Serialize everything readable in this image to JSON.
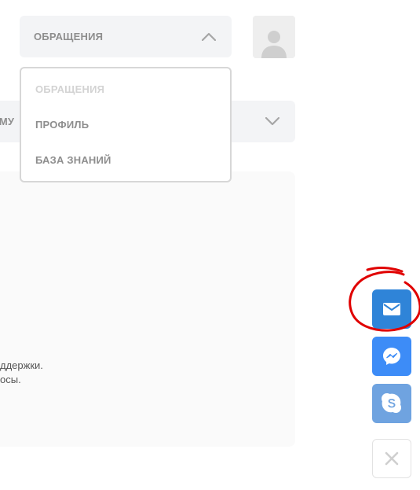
{
  "nav": {
    "selected": "ОБРАЩЕНИЯ",
    "menu_items": [
      {
        "label": "ОБРАЩЕНИЯ",
        "active": true
      },
      {
        "label": "ПРОФИЛЬ",
        "active": false
      },
      {
        "label": "БАЗА ЗНАНИЙ",
        "active": false
      }
    ]
  },
  "topic_select": {
    "label_fragment": "ЕМУ"
  },
  "content": {
    "line1": "ддержки.",
    "line2": "осы."
  },
  "contact_buttons": {
    "mail_icon": "mail-icon",
    "messenger_icon": "messenger-icon",
    "skype_icon": "skype-icon",
    "close_icon": "close-icon"
  },
  "colors": {
    "mail": "#2f84d8",
    "messenger": "#3d8cf7",
    "skype": "#6fa3e0",
    "annotation": "#e00000"
  }
}
